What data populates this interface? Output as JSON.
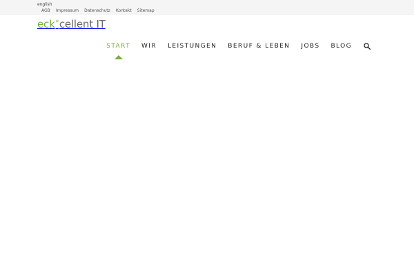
{
  "topbar": {
    "language_link": "english",
    "links": [
      "AGB",
      "Impressum",
      "Datenschutz",
      "Kontakt",
      "Sitemap"
    ]
  },
  "logo": {
    "part1": "eck",
    "asterisk": "*",
    "part2": "cellent IT"
  },
  "nav": {
    "items": [
      "START",
      "WIR",
      "LEISTUNGEN",
      "BERUF & LEBEN",
      "JOBS",
      "BLOG"
    ],
    "active_index": 0,
    "search_icon": "search-icon"
  },
  "colors": {
    "accent": "#7aad3b",
    "topbar_bg": "#f5f5f5",
    "text": "#222222"
  }
}
